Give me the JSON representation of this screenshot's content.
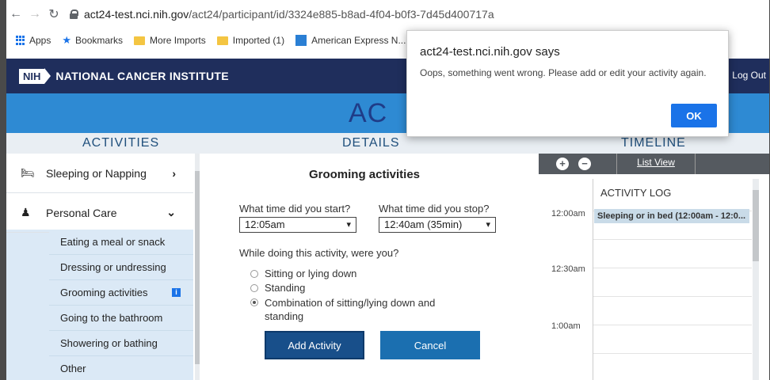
{
  "browser": {
    "url_host": "act24-test.nci.nih.gov",
    "url_path": "/act24/participant/id/3324e885-b8ad-4f04-b0f3-7d45d400717a",
    "bookmarks": [
      "Apps",
      "Bookmarks",
      "More Imports",
      "Imported (1)",
      "American Express N..."
    ]
  },
  "header": {
    "nih_box": "NIH",
    "institute": "NATIONAL CANCER INSTITUTE",
    "logout": "e | Log Out",
    "app_logo": "AC"
  },
  "columns": {
    "activities": "ACTIVITIES",
    "details": "DETAILS",
    "timeline": "TIMELINE"
  },
  "sidebar": {
    "main_items": [
      {
        "label": "Sleeping or Napping",
        "icon": "bed-icon",
        "chevron": "›"
      },
      {
        "label": "Personal Care",
        "icon": "person-icon",
        "chevron": "⌄"
      }
    ],
    "sub_items": [
      "Eating a meal or snack",
      "Dressing or undressing",
      "Grooming activities",
      "Going to the bathroom",
      "Showering or bathing",
      "Other"
    ],
    "info_badge": "i"
  },
  "details": {
    "title": "Grooming activities",
    "start_label": "What time did you start?",
    "start_value": "12:05am",
    "stop_label": "What time did you stop?",
    "stop_value": "12:40am  (35min)",
    "question": "While doing this activity, were you?",
    "options": [
      "Sitting or lying down",
      "Standing",
      "Combination of sitting/lying down and",
      "standing"
    ],
    "selected_option": 2,
    "add_button": "Add Activity",
    "cancel_button": "Cancel"
  },
  "timeline": {
    "zoom_in": "+",
    "zoom_out": "−",
    "list_view": "List View",
    "log_title": "ACTIVITY LOG",
    "times": [
      "12:00am",
      "12:30am",
      "1:00am"
    ],
    "event": "Sleeping or in bed (12:00am - 12:0..."
  },
  "dialog": {
    "title": "act24-test.nci.nih.gov says",
    "message": "Oops, something went wrong. Please add or edit your activity again.",
    "ok": "OK"
  }
}
